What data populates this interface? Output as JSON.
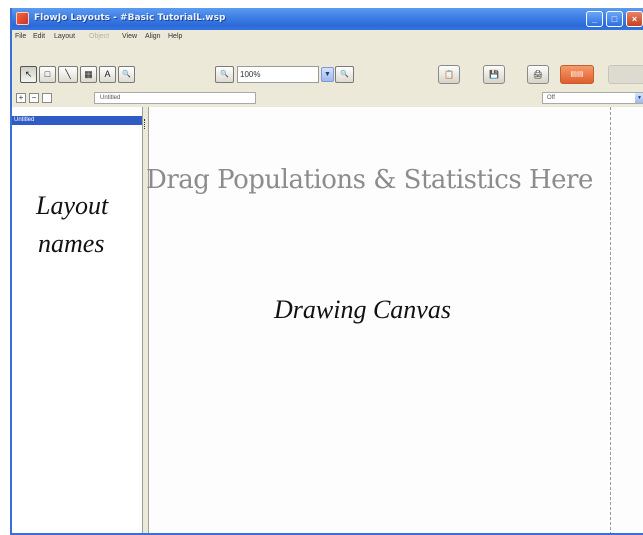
{
  "window": {
    "title": "FlowJo Layouts - #Basic TutorialL.wsp",
    "controls": {
      "minimize": "_",
      "maximize": "□",
      "close": "×"
    }
  },
  "menubar": {
    "items": [
      "File",
      "Edit",
      "Layout",
      "Object",
      "View",
      "Align",
      "Help"
    ],
    "disabled": [
      "Object"
    ]
  },
  "toolbar": {
    "tools": [
      {
        "name": "select-arrow-icon",
        "glyph": "↖"
      },
      {
        "name": "rectangle-tool-icon",
        "glyph": "□"
      },
      {
        "name": "line-tool-icon",
        "glyph": "╲"
      },
      {
        "name": "grid-tool-icon",
        "glyph": "▦"
      },
      {
        "name": "text-tool-icon",
        "glyph": "A"
      },
      {
        "name": "magnify-tool-icon",
        "glyph": "🔍"
      }
    ],
    "zoom_icon": "🔍",
    "zoom_value": "100%",
    "zoom_dropdown_glyph": "▼",
    "zoom_in_glyph": "🔍",
    "right_tools": [
      {
        "name": "clipboard-icon",
        "glyph": "📋"
      },
      {
        "name": "save-icon",
        "glyph": "💾"
      },
      {
        "name": "print-icon",
        "glyph": "🖨"
      },
      {
        "name": "batch-icon",
        "glyph": "▤▤"
      },
      {
        "name": "disabled-tool-icon",
        "glyph": ""
      }
    ]
  },
  "row2": {
    "add_glyph": "+",
    "remove_glyph": "−",
    "blank_glyph": "",
    "layout_name": "Untitled",
    "off_value": "Off",
    "off_arrow": "▼"
  },
  "sidebar": {
    "selected_layout": "Untitled"
  },
  "canvas": {
    "drop_hint": "Drag Populations & Statistics Here"
  },
  "annotations": {
    "layout_label_line1": "Layout",
    "layout_label_line2": "names",
    "canvas_label": "Drawing Canvas"
  }
}
